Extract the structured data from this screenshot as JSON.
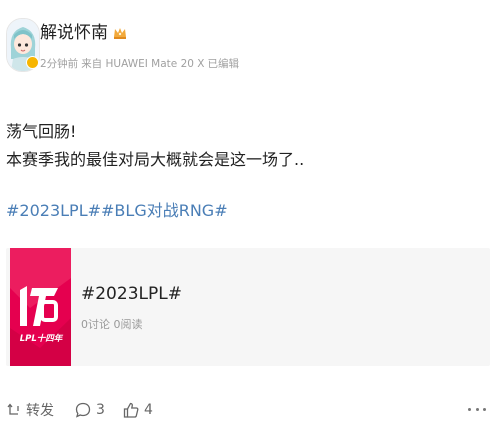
{
  "post": {
    "author": {
      "name": "解说怀南",
      "avatar_icon": "anime-avatar-icon",
      "verified_icon": "verified-badge-icon",
      "crown_icon": "crown-icon"
    },
    "meta": {
      "time": "2分钟前",
      "source": "来自 HUAWEI Mate 20 X",
      "edited": "已编辑"
    },
    "text_lines": [
      "荡气回肠!",
      "本赛季我的最佳对局大概就会是这一场了.."
    ],
    "hashtags": [
      "#2023LPL#",
      "#BLG对战RNG#"
    ]
  },
  "topic_card": {
    "title": "#2023LPL#",
    "stats": "0讨论 0阅读",
    "thumb_brand_color": "#e5004f",
    "thumb_logo_text": "LPL十四年"
  },
  "actions": {
    "repost_label": "转发",
    "comment_count": "3",
    "like_count": "4",
    "repost_icon": "repost-icon",
    "comment_icon": "comment-icon",
    "like_icon": "thumbs-up-icon",
    "more_icon": "more-icon"
  },
  "colors": {
    "link": "#4a7eb6",
    "meta": "#a0a0a0",
    "card_bg": "#f6f6f6"
  }
}
